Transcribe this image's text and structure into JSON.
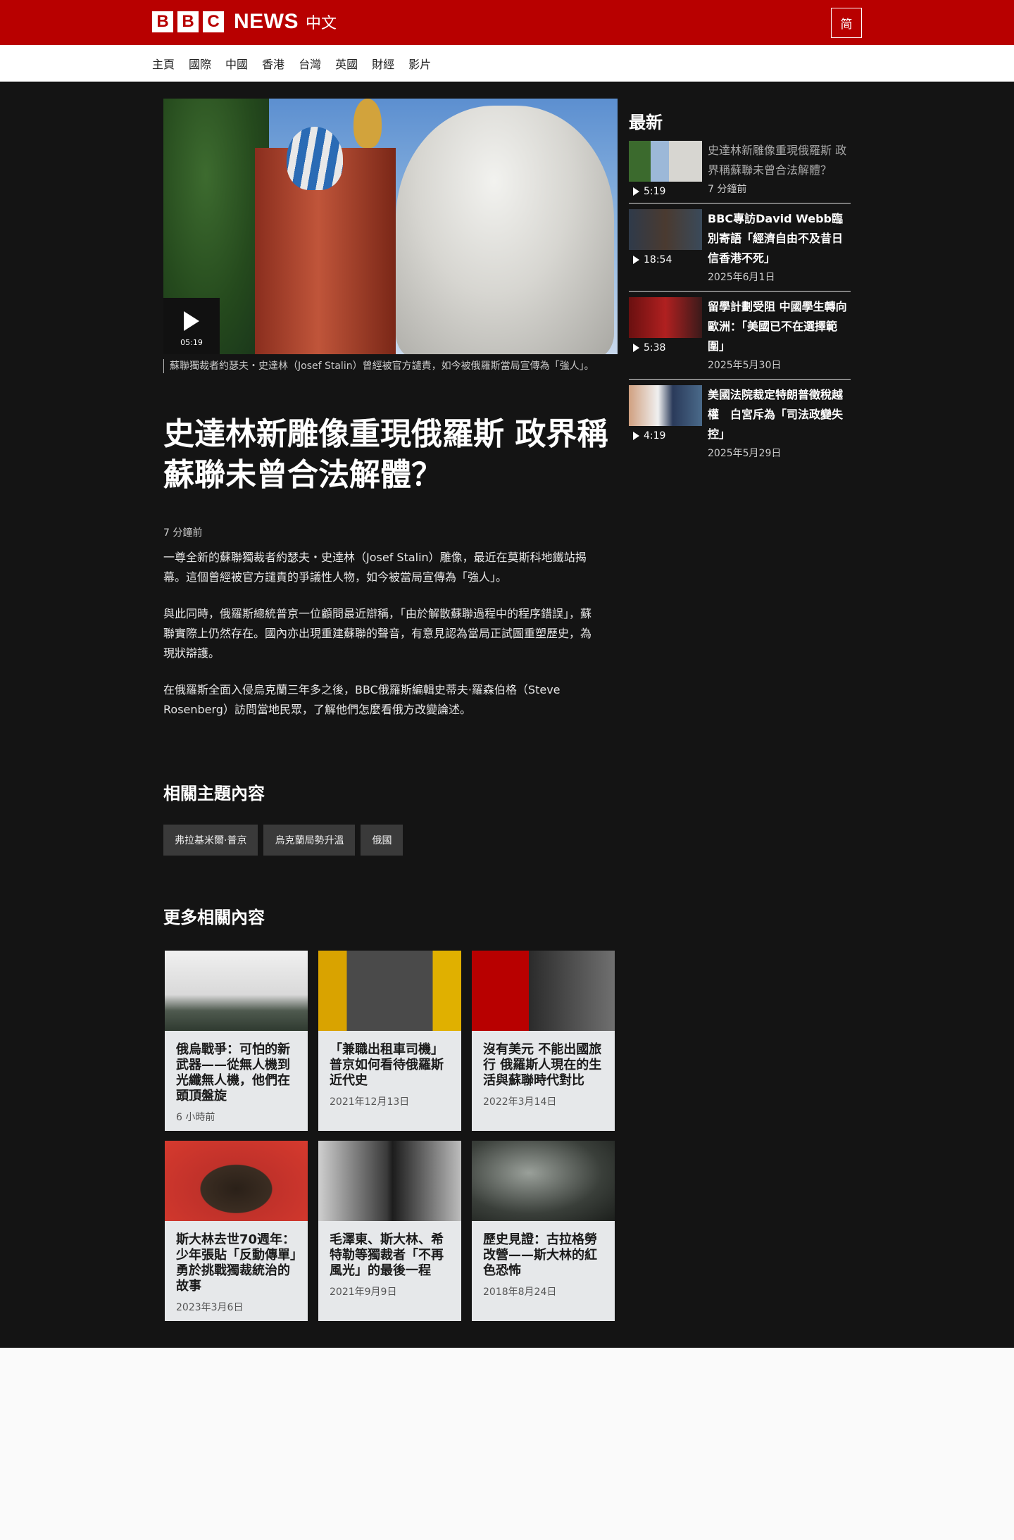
{
  "header": {
    "brand_letters": [
      "B",
      "B",
      "C"
    ],
    "brand_name": "NEWS",
    "brand_lang": "中文",
    "simplified_button": "简"
  },
  "nav": {
    "items": [
      "主頁",
      "國際",
      "中國",
      "香港",
      "台灣",
      "英國",
      "財經",
      "影片"
    ]
  },
  "video": {
    "duration": "05:19",
    "caption": "蘇聯獨裁者約瑟夫・史達林（Josef Stalin）曾經被官方譴責，如今被俄羅斯當局宣傳為「強人」。"
  },
  "article": {
    "headline": "史達林新雕像重現俄羅斯 政界稱蘇聯未曾合法解體？",
    "timestamp": "7 分鐘前",
    "paragraphs": [
      "一尊全新的蘇聯獨裁者約瑟夫・史達林（Josef Stalin）雕像，最近在莫斯科地鐵站揭幕。這個曾經被官方譴責的爭議性人物，如今被當局宣傳為「強人」。",
      "與此同時，俄羅斯總統普京一位顧問最近辯稱，「由於解散蘇聯過程中的程序錯誤」，蘇聯實際上仍然存在。國內亦出現重建蘇聯的聲音，有意見認為當局正試圖重塑歷史，為現狀辯護。",
      "在俄羅斯全面入侵烏克蘭三年多之後，BBC俄羅斯編輯史蒂夫·羅森伯格（Steve Rosenberg）訪問當地民眾，了解他們怎麼看俄方改變論述。"
    ]
  },
  "topics": {
    "heading": "相關主題內容",
    "tags": [
      "弗拉基米爾·普京",
      "烏克蘭局勢升溫",
      "俄國"
    ]
  },
  "more": {
    "heading": "更多相關內容",
    "cards": [
      {
        "title": "俄烏戰爭：可怕的新武器——從無人機到光纖無人機，他們在頭頂盤旋",
        "date": "6 小時前"
      },
      {
        "title": "「兼職出租車司機」普京如何看待俄羅斯近代史",
        "date": "2021年12月13日"
      },
      {
        "title": "沒有美元 不能出國旅行 俄羅斯人現在的生活與蘇聯時代對比",
        "date": "2022年3月14日"
      },
      {
        "title": "斯大林去世70週年：少年張貼「反動傳單」勇於挑戰獨裁統治的故事",
        "date": "2023年3月6日"
      },
      {
        "title": "毛澤東、斯大林、希特勒等獨裁者「不再風光」的最後一程",
        "date": "2021年9月9日"
      },
      {
        "title": "歷史見證：古拉格勞改營——斯大林的紅色恐怖",
        "date": "2018年8月24日"
      }
    ]
  },
  "latest": {
    "heading": "最新",
    "items": [
      {
        "title": "史達林新雕像重現俄羅斯 政界稱蘇聯未曾合法解體？",
        "date": "7 分鐘前",
        "duration": "5:19",
        "icon": "play-icon"
      },
      {
        "title": "BBC專訪David Webb臨別寄語「經濟自由不及昔日 信香港不死」",
        "date": "2025年6月1日",
        "duration": "18:54",
        "icon": "play-icon"
      },
      {
        "title": "留學計劃受阻 中國學生轉向歐洲：「美國已不在選擇範圍」",
        "date": "2025年5月30日",
        "duration": "5:38",
        "icon": "play-icon"
      },
      {
        "title": "美國法院裁定特朗普徵稅越權　白宮斥為「司法政變失控」",
        "date": "2025年5月29日",
        "duration": "4:19",
        "icon": "play-icon"
      }
    ]
  },
  "colors": {
    "brand_red": "#b80000",
    "page_dark": "#141414",
    "card_bg": "#e6e8ea"
  }
}
